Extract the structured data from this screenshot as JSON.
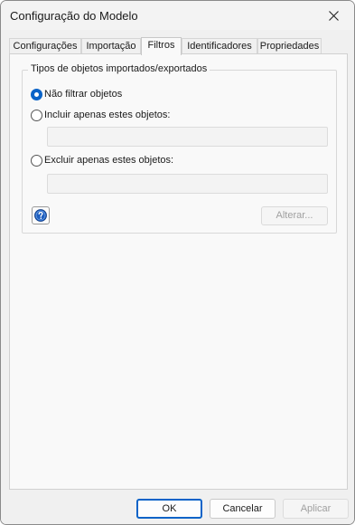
{
  "window": {
    "title": "Configuração do Modelo"
  },
  "tabs": [
    {
      "label": "Configurações",
      "active": false
    },
    {
      "label": "Importação",
      "active": false
    },
    {
      "label": "Filtros",
      "active": true
    },
    {
      "label": "Identificadores",
      "active": false
    },
    {
      "label": "Propriedades",
      "active": false
    }
  ],
  "filters": {
    "group_title": "Tipos de objetos importados/exportados",
    "options": [
      {
        "label": "Não filtrar objetos",
        "checked": true
      },
      {
        "label": "Incluir apenas estes objetos:",
        "checked": false,
        "field_value": ""
      },
      {
        "label": "Excluir apenas estes objetos:",
        "checked": false,
        "field_value": ""
      }
    ],
    "alter_label": "Alterar..."
  },
  "footer": {
    "ok_label": "OK",
    "cancel_label": "Cancelar",
    "apply_label": "Aplicar"
  },
  "colors": {
    "accent": "#0a63c8",
    "disabled_text": "#a0a0a0"
  }
}
